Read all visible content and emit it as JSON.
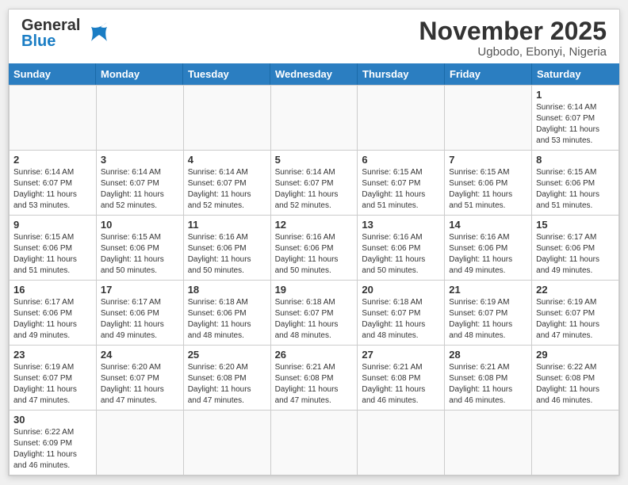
{
  "header": {
    "logo_general": "General",
    "logo_blue": "Blue",
    "month_title": "November 2025",
    "location": "Ugbodo, Ebonyi, Nigeria"
  },
  "day_headers": [
    "Sunday",
    "Monday",
    "Tuesday",
    "Wednesday",
    "Thursday",
    "Friday",
    "Saturday"
  ],
  "cells": [
    {
      "day": "",
      "empty": true
    },
    {
      "day": "",
      "empty": true
    },
    {
      "day": "",
      "empty": true
    },
    {
      "day": "",
      "empty": true
    },
    {
      "day": "",
      "empty": true
    },
    {
      "day": "",
      "empty": true
    },
    {
      "day": "1",
      "sunrise": "6:14 AM",
      "sunset": "6:07 PM",
      "daylight": "11 hours and 53 minutes."
    },
    {
      "day": "2",
      "sunrise": "6:14 AM",
      "sunset": "6:07 PM",
      "daylight": "11 hours and 53 minutes."
    },
    {
      "day": "3",
      "sunrise": "6:14 AM",
      "sunset": "6:07 PM",
      "daylight": "11 hours and 52 minutes."
    },
    {
      "day": "4",
      "sunrise": "6:14 AM",
      "sunset": "6:07 PM",
      "daylight": "11 hours and 52 minutes."
    },
    {
      "day": "5",
      "sunrise": "6:14 AM",
      "sunset": "6:07 PM",
      "daylight": "11 hours and 52 minutes."
    },
    {
      "day": "6",
      "sunrise": "6:15 AM",
      "sunset": "6:07 PM",
      "daylight": "11 hours and 51 minutes."
    },
    {
      "day": "7",
      "sunrise": "6:15 AM",
      "sunset": "6:06 PM",
      "daylight": "11 hours and 51 minutes."
    },
    {
      "day": "8",
      "sunrise": "6:15 AM",
      "sunset": "6:06 PM",
      "daylight": "11 hours and 51 minutes."
    },
    {
      "day": "9",
      "sunrise": "6:15 AM",
      "sunset": "6:06 PM",
      "daylight": "11 hours and 51 minutes."
    },
    {
      "day": "10",
      "sunrise": "6:15 AM",
      "sunset": "6:06 PM",
      "daylight": "11 hours and 50 minutes."
    },
    {
      "day": "11",
      "sunrise": "6:16 AM",
      "sunset": "6:06 PM",
      "daylight": "11 hours and 50 minutes."
    },
    {
      "day": "12",
      "sunrise": "6:16 AM",
      "sunset": "6:06 PM",
      "daylight": "11 hours and 50 minutes."
    },
    {
      "day": "13",
      "sunrise": "6:16 AM",
      "sunset": "6:06 PM",
      "daylight": "11 hours and 50 minutes."
    },
    {
      "day": "14",
      "sunrise": "6:16 AM",
      "sunset": "6:06 PM",
      "daylight": "11 hours and 49 minutes."
    },
    {
      "day": "15",
      "sunrise": "6:17 AM",
      "sunset": "6:06 PM",
      "daylight": "11 hours and 49 minutes."
    },
    {
      "day": "16",
      "sunrise": "6:17 AM",
      "sunset": "6:06 PM",
      "daylight": "11 hours and 49 minutes."
    },
    {
      "day": "17",
      "sunrise": "6:17 AM",
      "sunset": "6:06 PM",
      "daylight": "11 hours and 49 minutes."
    },
    {
      "day": "18",
      "sunrise": "6:18 AM",
      "sunset": "6:06 PM",
      "daylight": "11 hours and 48 minutes."
    },
    {
      "day": "19",
      "sunrise": "6:18 AM",
      "sunset": "6:07 PM",
      "daylight": "11 hours and 48 minutes."
    },
    {
      "day": "20",
      "sunrise": "6:18 AM",
      "sunset": "6:07 PM",
      "daylight": "11 hours and 48 minutes."
    },
    {
      "day": "21",
      "sunrise": "6:19 AM",
      "sunset": "6:07 PM",
      "daylight": "11 hours and 48 minutes."
    },
    {
      "day": "22",
      "sunrise": "6:19 AM",
      "sunset": "6:07 PM",
      "daylight": "11 hours and 47 minutes."
    },
    {
      "day": "23",
      "sunrise": "6:19 AM",
      "sunset": "6:07 PM",
      "daylight": "11 hours and 47 minutes."
    },
    {
      "day": "24",
      "sunrise": "6:20 AM",
      "sunset": "6:07 PM",
      "daylight": "11 hours and 47 minutes."
    },
    {
      "day": "25",
      "sunrise": "6:20 AM",
      "sunset": "6:08 PM",
      "daylight": "11 hours and 47 minutes."
    },
    {
      "day": "26",
      "sunrise": "6:21 AM",
      "sunset": "6:08 PM",
      "daylight": "11 hours and 47 minutes."
    },
    {
      "day": "27",
      "sunrise": "6:21 AM",
      "sunset": "6:08 PM",
      "daylight": "11 hours and 46 minutes."
    },
    {
      "day": "28",
      "sunrise": "6:21 AM",
      "sunset": "6:08 PM",
      "daylight": "11 hours and 46 minutes."
    },
    {
      "day": "29",
      "sunrise": "6:22 AM",
      "sunset": "6:08 PM",
      "daylight": "11 hours and 46 minutes."
    },
    {
      "day": "30",
      "sunrise": "6:22 AM",
      "sunset": "6:09 PM",
      "daylight": "11 hours and 46 minutes.",
      "lastrow": true
    },
    {
      "day": "",
      "empty": true,
      "lastrow": true
    },
    {
      "day": "",
      "empty": true,
      "lastrow": true
    },
    {
      "day": "",
      "empty": true,
      "lastrow": true
    },
    {
      "day": "",
      "empty": true,
      "lastrow": true
    },
    {
      "day": "",
      "empty": true,
      "lastrow": true
    },
    {
      "day": "",
      "empty": true,
      "lastrow": true
    }
  ]
}
